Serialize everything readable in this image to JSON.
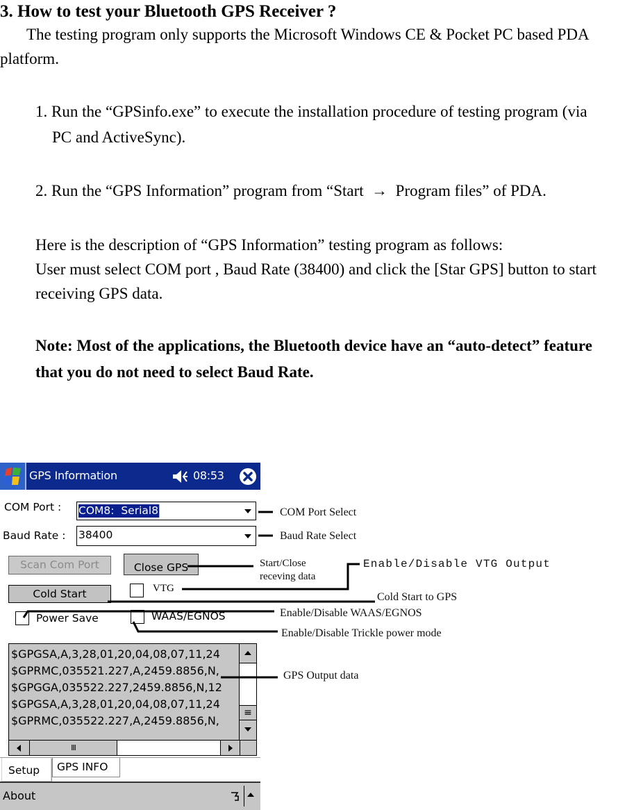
{
  "document": {
    "heading": "3. How to test your Bluetooth GPS Receiver ?",
    "intro_line1": "The testing program only supports the Microsoft Windows CE & Pocket PC based PDA",
    "intro_line2": "platform.",
    "step1_line1": "1. Run the “GPSinfo.exe” to execute the installation procedure of testing program (via",
    "step1_line2": "PC and ActiveSync).",
    "step2": "2. Run the “GPS Information” program from “Start  →  Program files” of PDA.",
    "description_lines": [
      "Here is the description of “GPS Information” testing program as follows:",
      "User must select COM port , Baud Rate (38400) and click the [Star GPS] button to start",
      "receiving GPS data."
    ],
    "note_lines": [
      "Note: Most of the applications, the Bluetooth device have an “auto-detect” feature",
      "that you do not need to select Baud Rate."
    ]
  },
  "app": {
    "title": "GPS Information",
    "time": "08:53",
    "colors": {
      "titlebar": "#0c2a8e",
      "selection": "#0a1f8f",
      "control_gray": "#c6c6c6"
    },
    "icons": {
      "start": "windows-flag-icon",
      "volume": "speaker-icon",
      "close": "close-circle-icon",
      "input": "input-method-icon",
      "menu_up": "arrow-up-icon"
    },
    "com_port": {
      "label": "COM Port :",
      "value": "COM8:  Serial8"
    },
    "baud_rate": {
      "label": "Baud Rate :",
      "value": "38400"
    },
    "buttons": {
      "scan_com_port": "Scan Com Port",
      "close_gps": "Close GPS",
      "cold_start": "Cold Start"
    },
    "checkboxes": {
      "vtg": {
        "label": "VTG",
        "checked": false
      },
      "power_save": {
        "label": "Power Save",
        "checked": false
      },
      "waas_egnos": {
        "label": "WAAS/EGNOS",
        "checked": false
      }
    },
    "output_lines": [
      "$GPGSA,A,3,28,01,20,04,08,07,11,24",
      "$GPRMC,035521.227,A,2459.8856,N,",
      "$GPGGA,035522.227,2459.8856,N,12",
      "$GPGSA,A,3,28,01,20,04,08,07,11,24",
      "$GPRMC,035522.227,A,2459.8856,N,"
    ],
    "hscroll_thumb_glyph": "III",
    "vscroll_thumb_glyph": "≡",
    "tabs": [
      {
        "label": "Setup",
        "active": true
      },
      {
        "label": "GPS INFO",
        "active": false
      }
    ],
    "menu": {
      "about": "About"
    }
  },
  "callouts": {
    "com_port_select": "COM Port Select",
    "baud_rate_select": "Baud Rate Select",
    "start_close_line1": "Start/Close",
    "start_close_line2": "receving data",
    "vtg_output": "Enable/Disable VTG Output",
    "cold_start": "Cold Start to GPS",
    "waas_egnos": "Enable/Disable WAAS/EGNOS",
    "trickle_power": "Enable/Disable Trickle power mode",
    "gps_output": "GPS Output data"
  }
}
